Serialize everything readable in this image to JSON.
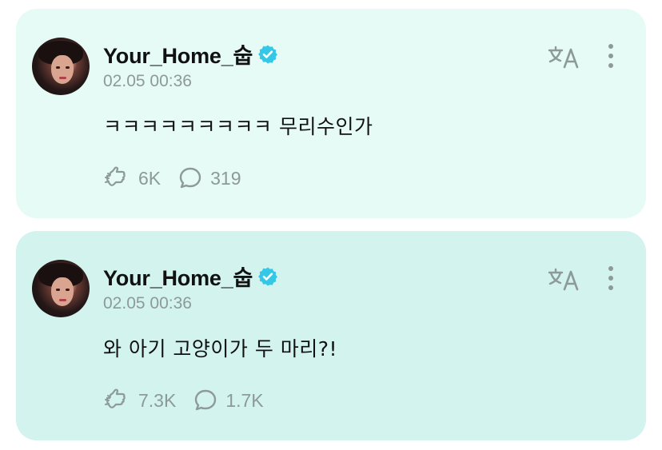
{
  "posts": [
    {
      "username": "Your_Home_숩",
      "timestamp": "02.05 00:36",
      "message": "ㅋㅋㅋㅋㅋㅋㅋㅋㅋ 무리수인가",
      "reactions": "6K",
      "comments": "319",
      "background": "#e6fbf6"
    },
    {
      "username": "Your_Home_숩",
      "timestamp": "02.05 00:36",
      "message": "와 아기 고양이가 두 마리?!",
      "reactions": "7.3K",
      "comments": "1.7K",
      "background": "#d3f3ef"
    }
  ],
  "icons": {
    "verified": "verified-badge-icon",
    "translate": "translate-icon",
    "more": "more-options-icon",
    "reaction": "reaction-hand-icon",
    "comment": "comment-bubble-icon"
  },
  "colors": {
    "verified": "#35c8e6",
    "muted": "#8d9a98",
    "text": "#111111"
  }
}
